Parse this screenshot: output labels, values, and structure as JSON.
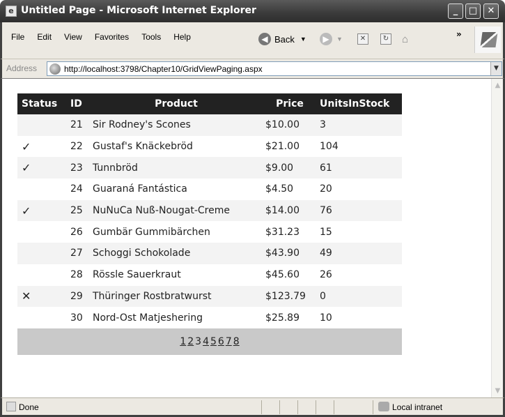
{
  "window": {
    "title": "Untitled Page - Microsoft Internet Explorer",
    "controls": {
      "minimize": "_",
      "maximize": "□",
      "close": "✕"
    }
  },
  "menu": [
    "File",
    "Edit",
    "View",
    "Favorites",
    "Tools",
    "Help"
  ],
  "toolbar": {
    "back_label": "Back",
    "more": "»"
  },
  "address": {
    "label": "Address",
    "url": "http://localhost:3798/Chapter10/GridViewPaging.aspx"
  },
  "grid": {
    "headers": [
      "Status",
      "ID",
      "Product",
      "Price",
      "UnitsInStock"
    ],
    "rows": [
      {
        "status": "",
        "id": "21",
        "product": "Sir Rodney's Scones",
        "price": "$10.00",
        "units": "3"
      },
      {
        "status": "✓",
        "id": "22",
        "product": "Gustaf's Knäckebröd",
        "price": "$21.00",
        "units": "104"
      },
      {
        "status": "✓",
        "id": "23",
        "product": "Tunnbröd",
        "price": "$9.00",
        "units": "61"
      },
      {
        "status": "",
        "id": "24",
        "product": "Guaraná Fantástica",
        "price": "$4.50",
        "units": "20"
      },
      {
        "status": "✓",
        "id": "25",
        "product": "NuNuCa Nuß-Nougat-Creme",
        "price": "$14.00",
        "units": "76"
      },
      {
        "status": "",
        "id": "26",
        "product": "Gumbär Gummibärchen",
        "price": "$31.23",
        "units": "15"
      },
      {
        "status": "",
        "id": "27",
        "product": "Schoggi Schokolade",
        "price": "$43.90",
        "units": "49"
      },
      {
        "status": "",
        "id": "28",
        "product": "Rössle Sauerkraut",
        "price": "$45.60",
        "units": "26"
      },
      {
        "status": "✕",
        "id": "29",
        "product": "Thüringer Rostbratwurst",
        "price": "$123.79",
        "units": "0"
      },
      {
        "status": "",
        "id": "30",
        "product": "Nord-Ost Matjeshering",
        "price": "$25.89",
        "units": "10"
      }
    ],
    "pager": {
      "pages": [
        "1",
        "2",
        "3",
        "4",
        "5",
        "6",
        "7",
        "8"
      ],
      "current": "3"
    }
  },
  "statusbar": {
    "text": "Done",
    "zone": "Local intranet"
  }
}
